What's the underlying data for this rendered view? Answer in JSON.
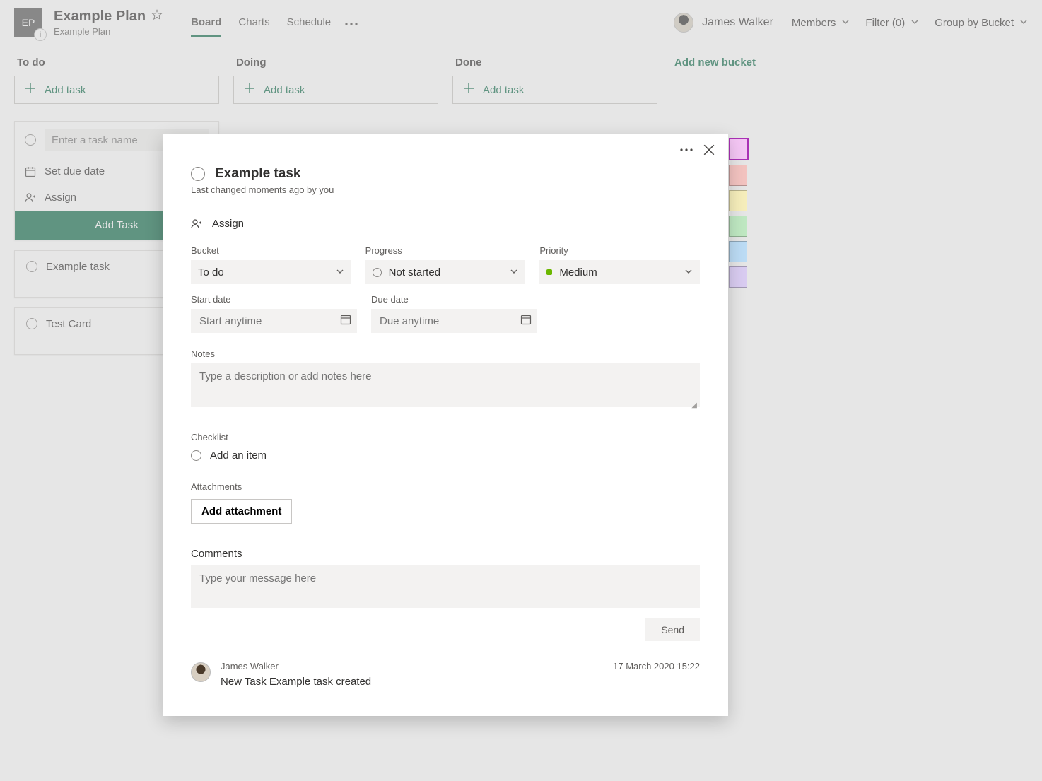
{
  "header": {
    "plan_initials": "EP",
    "plan_title": "Example Plan",
    "plan_subtitle": "Example Plan",
    "info_badge": "i",
    "tabs": [
      "Board",
      "Charts",
      "Schedule"
    ],
    "user_name": "James Walker",
    "controls": {
      "members": "Members",
      "filter": "Filter (0)",
      "group_by": "Group by Bucket"
    }
  },
  "board": {
    "buckets": [
      {
        "name": "To do",
        "add_label": "Add task"
      },
      {
        "name": "Doing",
        "add_label": "Add task"
      },
      {
        "name": "Done",
        "add_label": "Add task"
      }
    ],
    "new_bucket_label": "Add new bucket",
    "compose": {
      "name_placeholder": "Enter a task name",
      "due_label": "Set due date",
      "assign_label": "Assign",
      "submit_label": "Add Task"
    },
    "cards": [
      {
        "title": "Example task"
      },
      {
        "title": "Test Card"
      }
    ]
  },
  "label_colors": [
    "#f4c6f4",
    "#f3c3c0",
    "#f6eebb",
    "#bfe8c2",
    "#bcdcf5",
    "#d9ccf1"
  ],
  "modal": {
    "title": "Example task",
    "subtitle": "Last changed moments ago by you",
    "assign_label": "Assign",
    "fields": {
      "bucket_label": "Bucket",
      "bucket_value": "To do",
      "progress_label": "Progress",
      "progress_value": "Not started",
      "priority_label": "Priority",
      "priority_value": "Medium",
      "start_label": "Start date",
      "start_placeholder": "Start anytime",
      "due_label": "Due date",
      "due_placeholder": "Due anytime"
    },
    "notes_label": "Notes",
    "notes_placeholder": "Type a description or add notes here",
    "checklist_label": "Checklist",
    "checklist_add": "Add an item",
    "attachments_label": "Attachments",
    "add_attachment": "Add attachment",
    "comments_label": "Comments",
    "comment_placeholder": "Type your message here",
    "send_label": "Send",
    "activity": {
      "author": "James Walker",
      "timestamp": "17 March 2020 15:22",
      "text": "New Task Example task created"
    }
  }
}
